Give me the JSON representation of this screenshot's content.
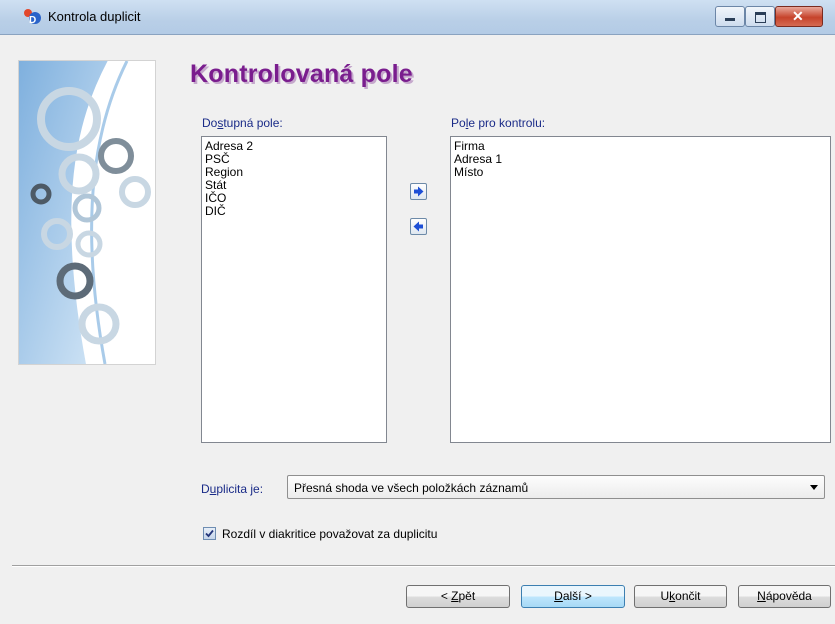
{
  "window": {
    "title": "Kontrola duplicit"
  },
  "page": {
    "heading": "Kontrolovaná pole"
  },
  "available": {
    "label_pre": "Do",
    "label_mn": "s",
    "label_post": "tupná pole:",
    "items": [
      "Adresa 2",
      "PSČ",
      "Region",
      "Stát",
      "IČO",
      "DIČ"
    ]
  },
  "checked": {
    "label_pre": "Po",
    "label_mn": "l",
    "label_post": "e pro kontrolu:",
    "items": [
      "Firma",
      "Adresa 1",
      "Místo"
    ]
  },
  "duplicate": {
    "label_pre": "D",
    "label_mn": "u",
    "label_post": "plicita je:",
    "selected": "Přesná shoda ve všech položkách záznamů"
  },
  "diacritics": {
    "label": "Rozdíl v diakritice považovat za duplicitu",
    "checked": true
  },
  "buttons": {
    "back_pre": "< ",
    "back_mn": "Z",
    "back_post": "pět",
    "next_mn": "D",
    "next_post": "alší >",
    "quit_pre": "U",
    "quit_mn": "k",
    "quit_post": "ončit",
    "help_mn": "N",
    "help_post": "ápověda"
  },
  "icons": [
    "app-icon",
    "arrow-right-icon",
    "arrow-left-icon",
    "gear-illustration",
    "checkmark-icon"
  ],
  "colors": {
    "heading": "#7a1d8e",
    "label": "#1a2b88",
    "arrow": "#1d4fd6",
    "close_button": "#c6432b"
  }
}
